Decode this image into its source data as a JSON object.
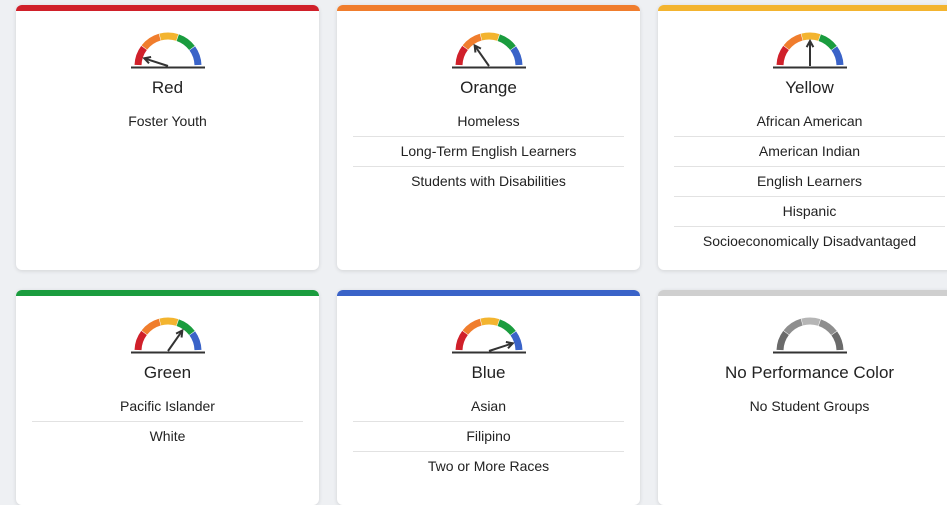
{
  "cards": [
    {
      "title": "Red",
      "accent": "#d0202a",
      "gauge_level": "red",
      "groups": [
        "Foster Youth"
      ]
    },
    {
      "title": "Orange",
      "accent": "#f07d2d",
      "gauge_level": "orange",
      "groups": [
        "Homeless",
        "Long-Term English Learners",
        "Students with Disabilities"
      ]
    },
    {
      "title": "Yellow",
      "accent": "#f3b42f",
      "gauge_level": "yellow",
      "groups": [
        "African American",
        "American Indian",
        "English Learners",
        "Hispanic",
        "Socioeconomically Disadvantaged"
      ]
    },
    {
      "title": "Green",
      "accent": "#1a9c3e",
      "gauge_level": "green",
      "groups": [
        "Pacific Islander",
        "White"
      ]
    },
    {
      "title": "Blue",
      "accent": "#3a63c8",
      "gauge_level": "blue",
      "groups": [
        "Asian",
        "Filipino",
        "Two or More Races"
      ]
    },
    {
      "title": "No Performance Color",
      "accent": "#cfcfcf",
      "gauge_level": "none",
      "groups": [
        "No Student Groups"
      ]
    }
  ],
  "gauge_colors": {
    "red": "#d0202a",
    "orange": "#f07d2d",
    "yellow": "#f3b42f",
    "green": "#1a9c3e",
    "blue": "#3a63c8",
    "grey_dark": "#6b6b6b",
    "grey_mid": "#8e8e8e",
    "grey_light": "#b5b5b5",
    "needle": "#333333"
  }
}
